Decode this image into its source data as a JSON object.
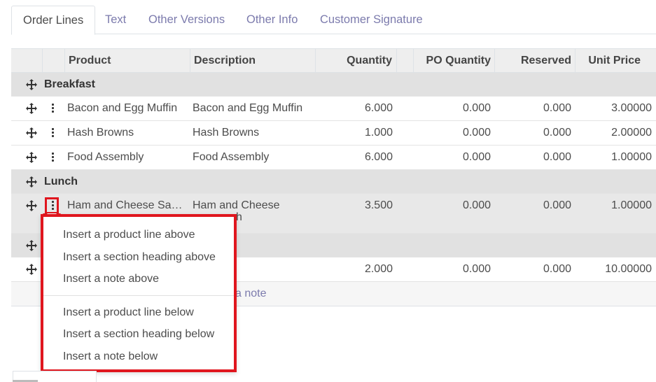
{
  "tabs": [
    {
      "label": "Order Lines",
      "active": true
    },
    {
      "label": "Text",
      "active": false
    },
    {
      "label": "Other Versions",
      "active": false
    },
    {
      "label": "Other Info",
      "active": false
    },
    {
      "label": "Customer Signature",
      "active": false
    }
  ],
  "table": {
    "headers": {
      "product": "Product",
      "description": "Description",
      "quantity": "Quantity",
      "po_quantity": "PO Quantity",
      "reserved": "Reserved",
      "unit_price": "Unit Price"
    },
    "section_breakfast": "Breakfast",
    "rows_breakfast": [
      {
        "product": "Bacon and Egg Muffin",
        "description": "Bacon and Egg Muffin",
        "quantity": "6.000",
        "po_quantity": "0.000",
        "reserved": "0.000",
        "unit_price": "3.00000"
      },
      {
        "product": "Hash Browns",
        "description": "Hash Browns",
        "quantity": "1.000",
        "po_quantity": "0.000",
        "reserved": "0.000",
        "unit_price": "2.00000"
      },
      {
        "product": "Food Assembly",
        "description": "Food Assembly",
        "quantity": "6.000",
        "po_quantity": "0.000",
        "reserved": "0.000",
        "unit_price": "1.00000"
      }
    ],
    "section_lunch": "Lunch",
    "row_lunch": {
      "product": "Ham and Cheese Sa…",
      "description": "Ham and Cheese",
      "description_line2": "h",
      "quantity": "3.500",
      "po_quantity": "0.000",
      "reserved": "0.000",
      "unit_price": "1.00000"
    },
    "row_last": {
      "quantity": "2.000",
      "po_quantity": "0.000",
      "reserved": "0.000",
      "unit_price": "10.00000"
    },
    "add_note_fragment": "a note"
  },
  "menu": {
    "above": [
      "Insert a product line above",
      "Insert a section heading above",
      "Insert a note above"
    ],
    "below": [
      "Insert a product line below",
      "Insert a section heading below",
      "Insert a note below"
    ]
  },
  "colors": {
    "highlight": "#e0161e",
    "link": "#7c7bad"
  }
}
